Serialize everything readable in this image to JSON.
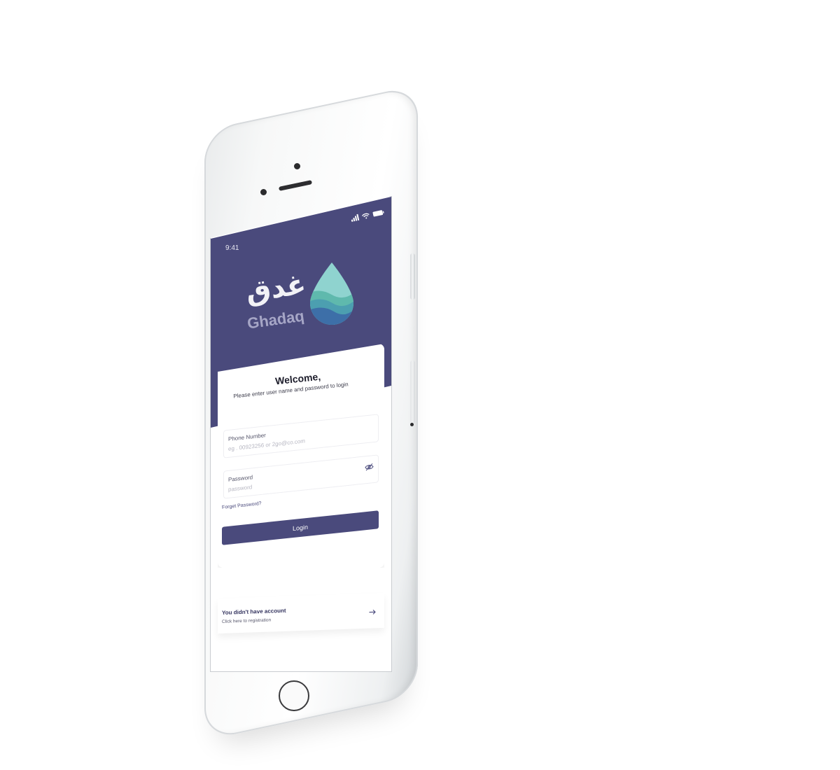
{
  "status_bar": {
    "time": "9:41",
    "icons": [
      "signal-icon",
      "wifi-icon",
      "battery-icon"
    ]
  },
  "logo": {
    "arabic": "غدق",
    "latin": "Ghadaq",
    "icon": "water-drop-icon"
  },
  "login": {
    "title": "Welcome,",
    "subtitle": "Please enter user name and password to login",
    "phone_label": "Phone Number",
    "phone_placeholder": "eg . 00923256 or 2go@co.com",
    "phone_value": "",
    "password_label": "Password",
    "password_placeholder": "password",
    "password_value": "",
    "password_toggle_icon": "eye-off-icon",
    "forgot_label": "Forget Password?",
    "login_label": "Login"
  },
  "register": {
    "title": "You didn't have account",
    "subtitle": "Click here to registration",
    "icon": "arrow-right-icon"
  },
  "colors": {
    "brand": "#4a4a7c",
    "drop_teal": "#5fc3b7",
    "drop_blue": "#3d6fa8",
    "background": "#ffffff"
  }
}
